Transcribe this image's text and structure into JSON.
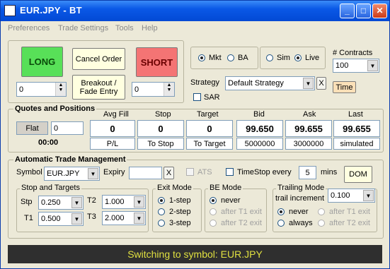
{
  "window": {
    "title": "EUR.JPY  - BT"
  },
  "menu": [
    "Preferences",
    "Trade Settings",
    "Tools",
    "Help"
  ],
  "order": {
    "long_label": "LONG",
    "short_label": "SHORT",
    "cancel_label": "Cancel Order",
    "breakout_line1": "Breakout /",
    "breakout_line2": "Fade Entry",
    "long_qty": "0",
    "short_qty": "0"
  },
  "mode": {
    "mkt": "Mkt",
    "ba": "BA",
    "sim": "Sim",
    "live": "Live"
  },
  "contracts": {
    "label": "# Contracts",
    "value": "100"
  },
  "strategy": {
    "label": "Strategy",
    "value": "Default Strategy",
    "clear": "X",
    "time_label": "Time",
    "sar_label": "SAR"
  },
  "quotes": {
    "legend": "Quotes and Positions",
    "position_label": "Flat",
    "position_qty": "0",
    "time": "00:00",
    "headers": [
      "Avg Fill",
      "Stop",
      "Target",
      "Bid",
      "Ask",
      "Last"
    ],
    "values": [
      "0",
      "0",
      "0",
      "99.650",
      "99.655",
      "99.655"
    ],
    "subs": [
      "P/L",
      "To Stop",
      "To Target",
      "5000000",
      "3000000",
      "simulated"
    ]
  },
  "atm": {
    "legend": "Automatic Trade Management",
    "symbol_label": "Symbol",
    "symbol_value": "EUR.JPY",
    "expiry_label": "Expiry",
    "expiry_clear": "X",
    "ats_label": "ATS",
    "timestop_label": "TimeStop every",
    "timestop_value": "5",
    "mins_label": "mins",
    "dom_label": "DOM"
  },
  "stops": {
    "legend": "Stop and Targets",
    "stp_label": "Stp",
    "stp_value": "0.250",
    "t1_label": "T1",
    "t1_value": "0.500",
    "t2_label": "T2",
    "t2_value": "1.000",
    "t3_label": "T3",
    "t3_value": "2.000"
  },
  "exit": {
    "legend": "Exit Mode",
    "options": [
      "1-step",
      "2-step",
      "3-step"
    ]
  },
  "be": {
    "legend": "BE Mode",
    "options": [
      "never",
      "after T1 exit",
      "after T2 exit"
    ]
  },
  "trailing": {
    "legend": "Trailing Mode",
    "increment_label": "trail increment",
    "increment_value": "0.100",
    "opt_never": "never",
    "opt_always": "always",
    "opt_t1": "after T1 exit",
    "opt_t2": "after T2 exit"
  },
  "status": {
    "message": "Switching to symbol: EUR.JPY"
  },
  "colors": {
    "long": "#58e058",
    "short": "#f47474",
    "cream": "#ffffe0",
    "status_bg": "#2f2f2f",
    "status_fg": "#e0e040"
  }
}
